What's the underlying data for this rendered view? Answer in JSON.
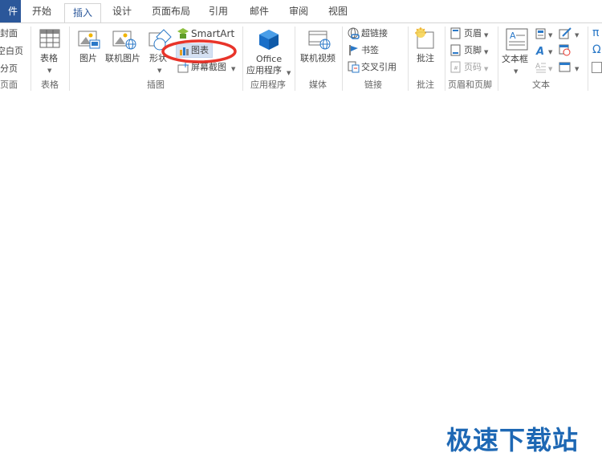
{
  "tabs": {
    "file": "件",
    "home": "开始",
    "insert": "插入",
    "design": "设计",
    "layout": "页面布局",
    "references": "引用",
    "mailings": "邮件",
    "review": "审阅",
    "view": "视图"
  },
  "ribbon": {
    "pages": {
      "cover": "封面",
      "blank": "空白页",
      "break": "分页",
      "group": "页面"
    },
    "table": {
      "label": "表格",
      "group": "表格"
    },
    "illustrations": {
      "picture": "图片",
      "online_picture": "联机图片",
      "shapes": "形状",
      "smartart": "SmartArt",
      "chart": "图表",
      "screenshot": "屏幕截图",
      "group": "插图"
    },
    "apps": {
      "office_line1": "Office",
      "office_line2": "应用程序",
      "group": "应用程序"
    },
    "media": {
      "online_video": "联机视频",
      "group": "媒体"
    },
    "links": {
      "hyperlink": "超链接",
      "bookmark": "书签",
      "cross_ref": "交叉引用",
      "group": "链接"
    },
    "comments": {
      "comment": "批注",
      "group": "批注"
    },
    "header_footer": {
      "header": "页眉",
      "footer": "页脚",
      "page_number": "页码",
      "group": "页眉和页脚"
    },
    "text": {
      "textbox": "文本框",
      "group": "文本"
    }
  },
  "watermark": "极速下载站",
  "colors": {
    "accent": "#2b579a",
    "highlight": "#e8342a",
    "watermark": "#1e68b4"
  }
}
